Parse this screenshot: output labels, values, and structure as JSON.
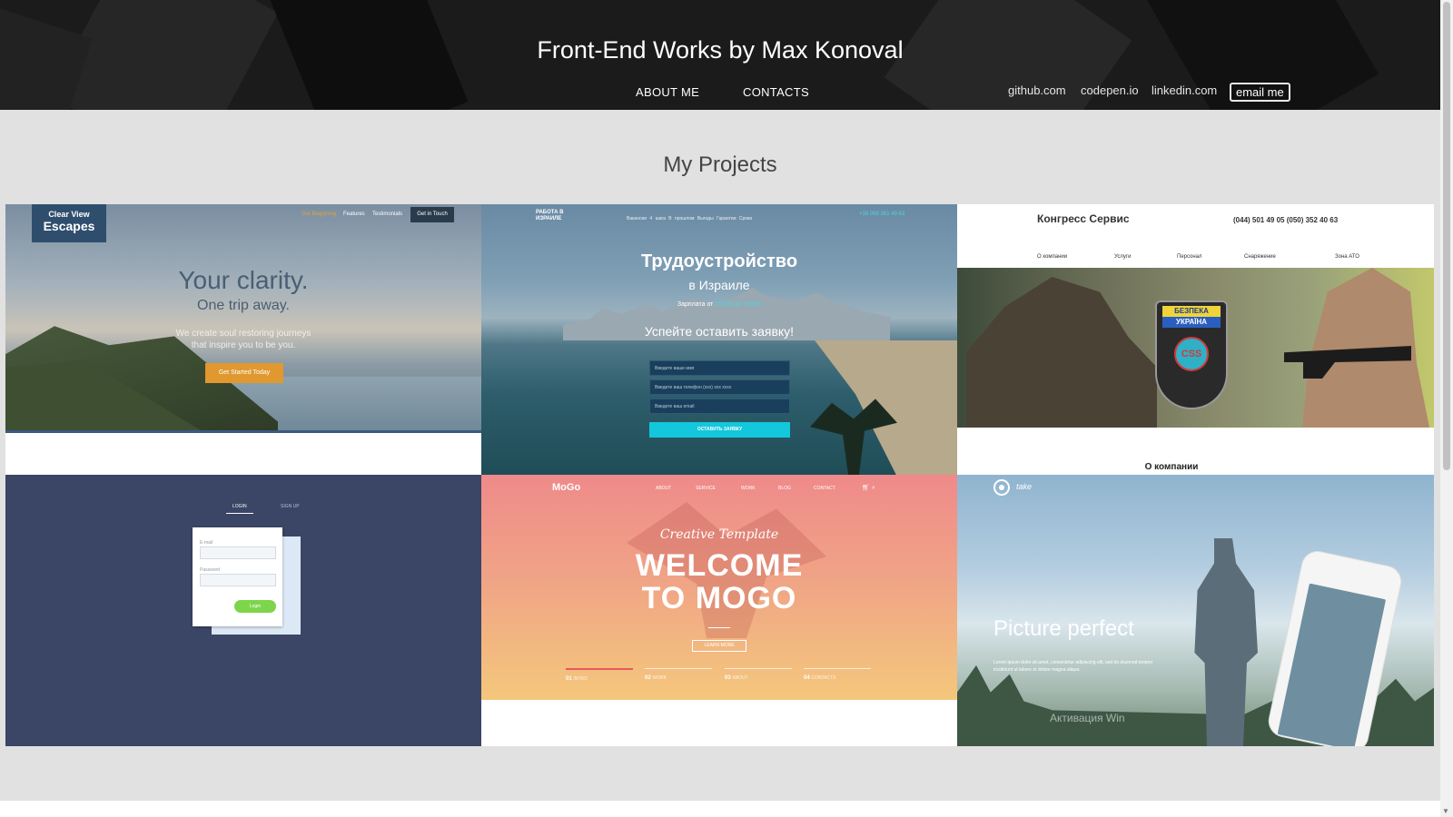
{
  "header": {
    "title": "Front-End Works by Max Konoval",
    "nav": {
      "about": "ABOUT ME",
      "contacts": "CONTACTS"
    },
    "social": {
      "github": "github.com",
      "codepen": "codepen.io",
      "linkedin": "linkedin.com",
      "email": "email me"
    }
  },
  "main": {
    "section_title": "My Projects",
    "projects": [
      {
        "logo_line1": "Clear View",
        "logo_line2": "Escapes",
        "menu": [
          "Our Beginning",
          "Features",
          "Testimonials"
        ],
        "menu_button": "Get in Touch",
        "heading": "Your clarity.",
        "subheading": "One trip away.",
        "text_line1": "We create soul restoring journeys",
        "text_line2": "that inspire you to be you.",
        "cta": "Get Started Today"
      },
      {
        "logo": "РАБОТА В ИЗРАИЛЕ",
        "menu": "Вакансии  4 шага  В прошлом  Выгоды  Гарантии  Сроки",
        "phone": "+38 098 361 49 63",
        "heading": "Трудоустройство",
        "subheading": "в Израиле",
        "salary_prefix": "Зарплата от",
        "salary_value": "1500$ до 2500$",
        "form_heading": "Успейте оставить заявку!",
        "placeholder_name": "Введите ваше имя",
        "placeholder_phone": "Введите ваш телефон (ххх) ххх хххх",
        "placeholder_email": "Введите ваш email",
        "submit": "ОСТАВИТЬ ЗАЯВКУ"
      },
      {
        "title": "Конгресс Сервис",
        "phones": "(044) 501 49 05  (050) 352 40 63",
        "menu": [
          "О компании",
          "Услуги",
          "Персонал",
          "Снаряжение",
          "Зона АТО"
        ],
        "shield_top": "БЕЗПЕКА",
        "shield_mid": "УКРАЇНА",
        "shield_logo": "CSS",
        "about": "О компании"
      },
      {
        "tab_login": "LOGIN",
        "tab_signup": "SIGN UP",
        "label_email": "E-mail",
        "label_password": "Password",
        "button": "Login"
      },
      {
        "logo": "MoGo",
        "nav": [
          "ABOUT",
          "SERVICE",
          "WORK",
          "BLOG",
          "CONTACT"
        ],
        "script": "Creative Template",
        "heading_line1": "WELCOME",
        "heading_line2": "TO MOGO",
        "button": "LEARN MORE",
        "steps": [
          {
            "num": "01",
            "label": "INTRO"
          },
          {
            "num": "02",
            "label": "WORK"
          },
          {
            "num": "03",
            "label": "ABOUT"
          },
          {
            "num": "04",
            "label": "CONTACTS"
          }
        ]
      },
      {
        "logo": "take",
        "heading": "Picture perfect",
        "text": "Lorem ipsum dolor sit amet, consectetur adipiscing elit, sed do eiusmod tempor incididunt ut labore et dolore magna aliqua.",
        "activation": "Активация Win"
      }
    ]
  },
  "colors": {
    "header_bg": "#1b1b1b",
    "page_bg": "#e1e1e1",
    "accent_orange": "#e0982f",
    "accent_cyan": "#13c7dc",
    "accent_green": "#7dd54b",
    "login_bg": "#3b4565"
  }
}
